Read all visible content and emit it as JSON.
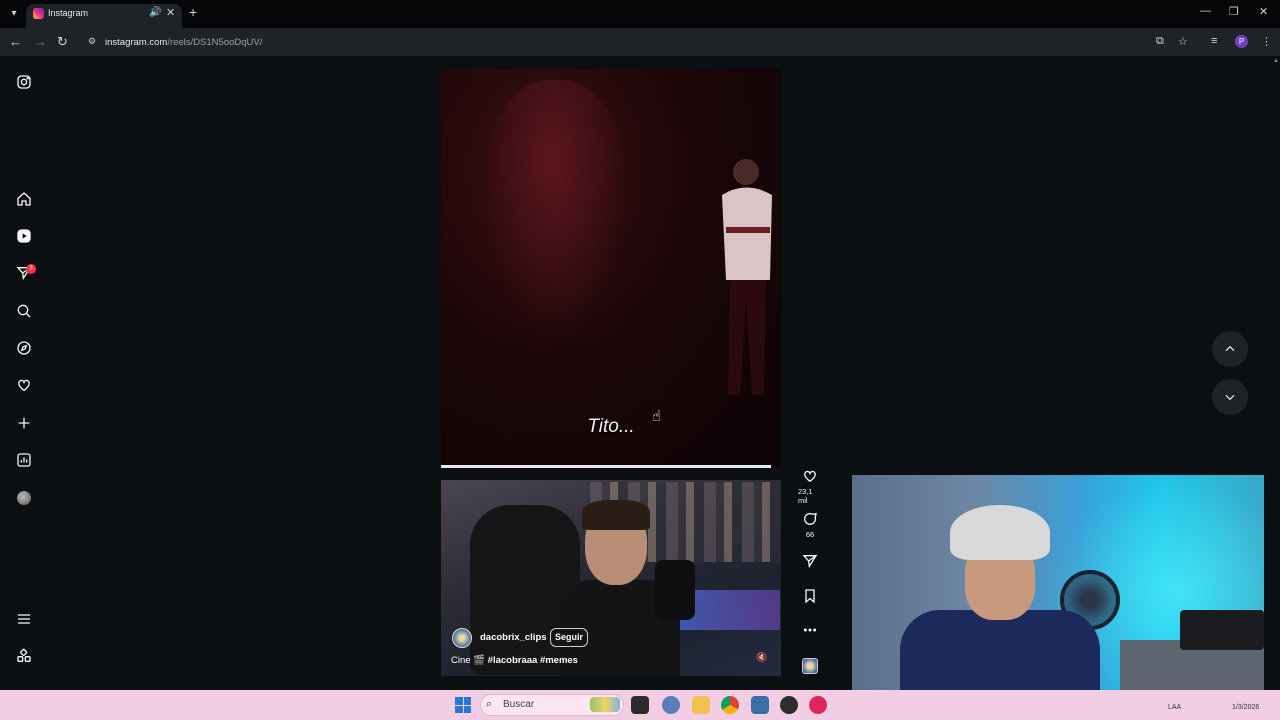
{
  "browser": {
    "tab_title": "Instagram",
    "url_host": "instagram.com",
    "url_path": "/reels/DS1N5ooDqUV/",
    "profile_initial": "P"
  },
  "sidebar": {
    "notification_count": "3"
  },
  "reel": {
    "overlay_caption": "Tito...",
    "progress": 1.0,
    "author": "dacobrix_clips",
    "follow_label": "Seguir",
    "caption_prefix": "Cine 🎬 ",
    "caption_tags": "#lacobraaa #memes",
    "likes": "23,1 mil",
    "comments": "66"
  },
  "taskbar": {
    "search_placeholder": "Buscar",
    "tray_lang": "LAA",
    "tray_time": "1/3/2026"
  },
  "colors": {
    "page_bg": "#0c0f12",
    "chrome_bg": "#1f2327",
    "taskbar_bg": "#f3cde3",
    "badge": "#ff3040"
  },
  "icons": {
    "sidebar": [
      "instagram-logo-icon",
      "home-icon",
      "reels-icon",
      "direct-icon",
      "search-icon",
      "explore-icon",
      "heart-icon",
      "create-icon",
      "dashboard-icon",
      "profile-avatar",
      "menu-icon",
      "also-from-meta-icon"
    ],
    "actions": [
      "like-icon",
      "comment-icon",
      "share-icon",
      "save-icon",
      "more-icon",
      "audio-icon"
    ]
  }
}
